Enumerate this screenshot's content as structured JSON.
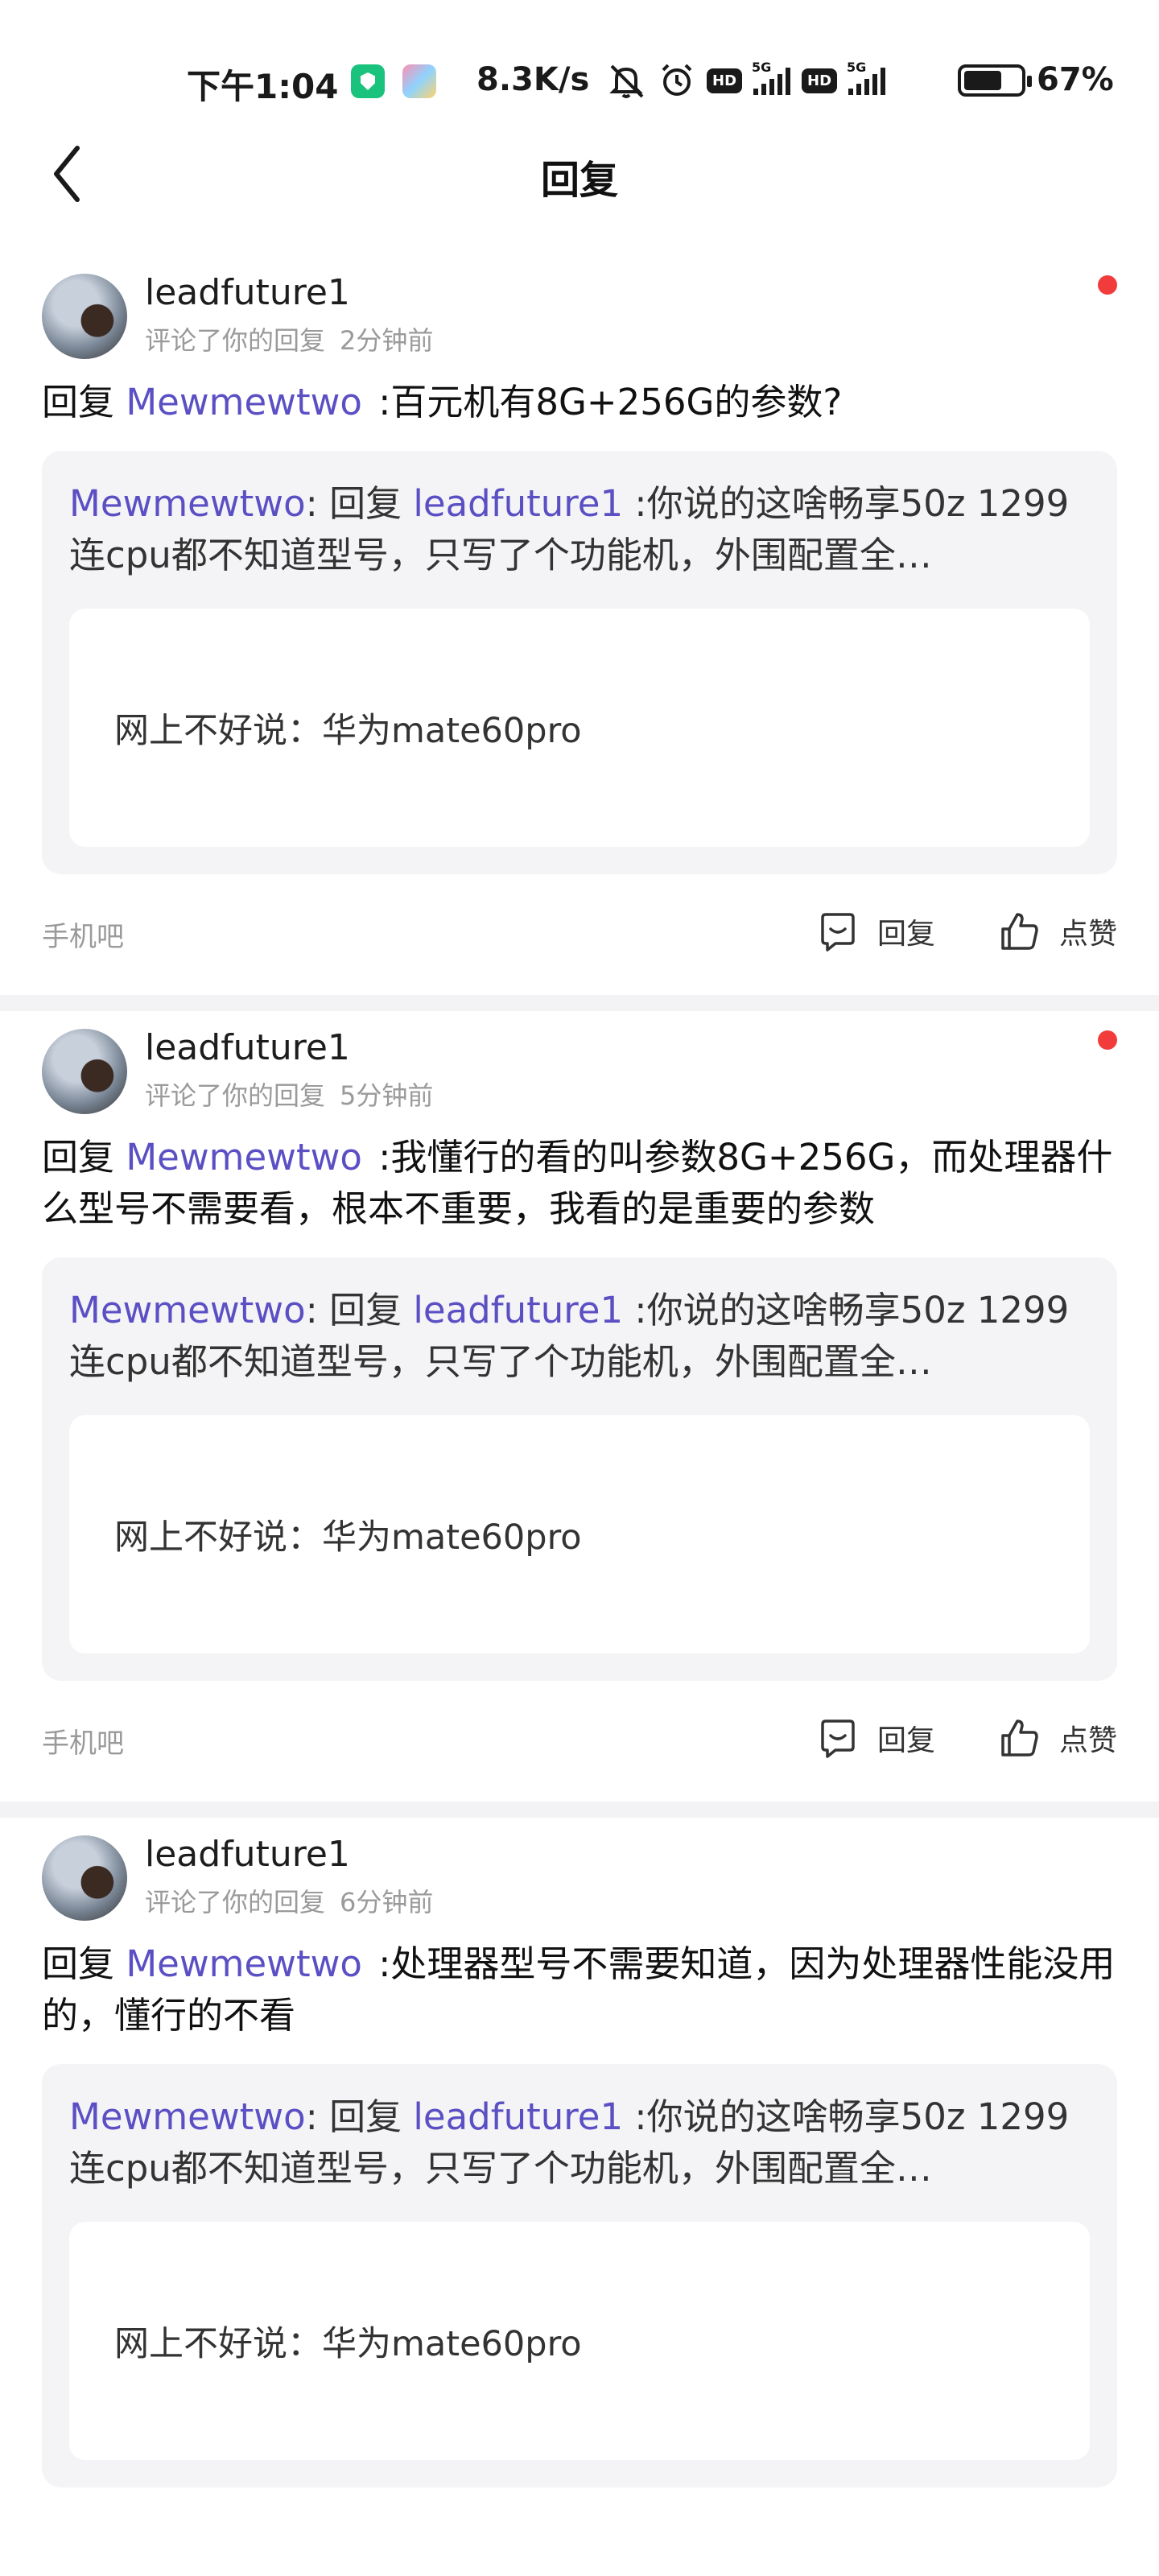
{
  "status_bar": {
    "time": "下午1:04",
    "net_speed": "8.3K/s",
    "hd1": "HD",
    "hd2": "HD",
    "net1": "5G",
    "net2": "5G",
    "battery": "67%"
  },
  "nav": {
    "title": "回复"
  },
  "notifications": [
    {
      "user": "leadfuture1",
      "action": "评论了你的回复",
      "time": "2分钟前",
      "unread": true,
      "reply_prefix": "回复",
      "reply_mention": "Mewmewtwo",
      "reply_body": ":百元机有8G+256G的参数?",
      "quote_author": "Mewmewtwo",
      "quote_sep": ": 回复",
      "quote_mention": "leadfuture1",
      "quote_body": ":你说的这啥畅享50z 1299连cpu都不知道型号，只写了个功能机，外围配置全…",
      "inner_text": "网上不好说：华为mate60pro",
      "forum": "手机吧",
      "reply_label": "回复",
      "like_label": "点赞"
    },
    {
      "user": "leadfuture1",
      "action": "评论了你的回复",
      "time": "5分钟前",
      "unread": true,
      "reply_prefix": "回复",
      "reply_mention": "Mewmewtwo",
      "reply_body": ":我懂行的看的叫参数8G+256G，而处理器什么型号不需要看，根本不重要，我看的是重要的参数",
      "quote_author": "Mewmewtwo",
      "quote_sep": ": 回复",
      "quote_mention": "leadfuture1",
      "quote_body": ":你说的这啥畅享50z 1299连cpu都不知道型号，只写了个功能机，外围配置全…",
      "inner_text": "网上不好说：华为mate60pro",
      "forum": "手机吧",
      "reply_label": "回复",
      "like_label": "点赞"
    },
    {
      "user": "leadfuture1",
      "action": "评论了你的回复",
      "time": "6分钟前",
      "unread": false,
      "reply_prefix": "回复",
      "reply_mention": "Mewmewtwo",
      "reply_body": ":处理器型号不需要知道，因为处理器性能没用的，懂行的不看",
      "quote_author": "Mewmewtwo",
      "quote_sep": ": 回复",
      "quote_mention": "leadfuture1",
      "quote_body": ":你说的这啥畅享50z 1299连cpu都不知道型号，只写了个功能机，外围配置全…",
      "inner_text": "网上不好说：华为mate60pro"
    }
  ],
  "colors": {
    "mention": "#5b4fc4",
    "unread_dot": "#f23c3c",
    "quote_bg": "#f4f4f6",
    "separator": "#f3f3f5"
  }
}
